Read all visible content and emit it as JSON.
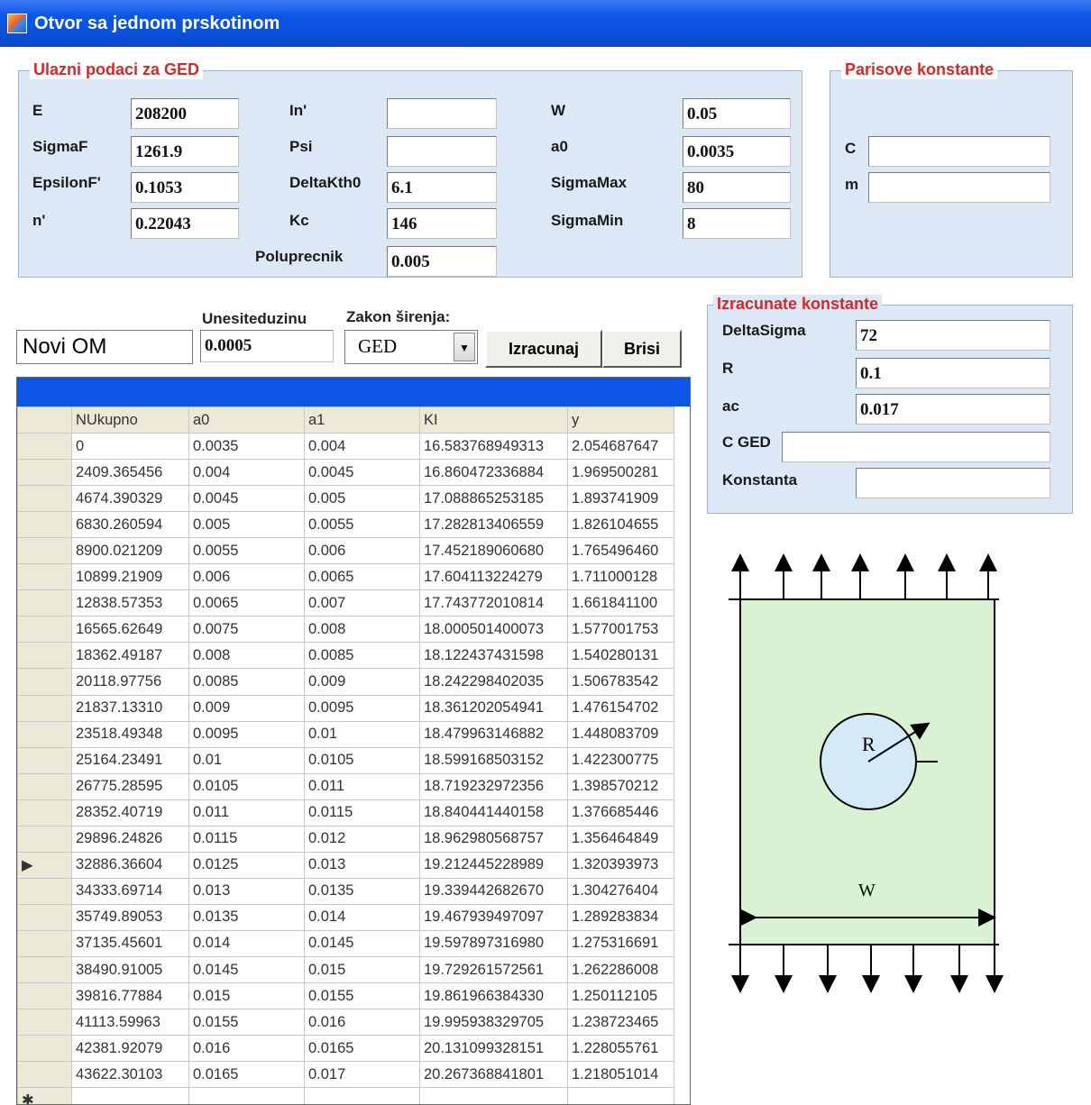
{
  "window": {
    "title": "Otvor sa jednom prskotinom"
  },
  "input_group": {
    "legend": "Ulazni podaci za GED",
    "E": {
      "label": "E",
      "value": "208200"
    },
    "SigmaF": {
      "label": "SigmaF",
      "value": "1261.9"
    },
    "EpsilonF": {
      "label": "EpsilonF'",
      "value": "0.1053"
    },
    "n": {
      "label": "n'",
      "value": "0.22043"
    },
    "In": {
      "label": "In'",
      "value": ""
    },
    "Psi": {
      "label": "Psi",
      "value": ""
    },
    "DeltaKth0": {
      "label": "DeltaKth0",
      "value": "6.1"
    },
    "Kc": {
      "label": "Kc",
      "value": "146"
    },
    "Poluprecnik": {
      "label": "Poluprecnik",
      "value": "0.005"
    },
    "W": {
      "label": "W",
      "value": "0.05"
    },
    "a0": {
      "label": "a0",
      "value": "0.0035"
    },
    "SigmaMax": {
      "label": "SigmaMax",
      "value": "80"
    },
    "SigmaMin": {
      "label": "SigmaMin",
      "value": "8"
    }
  },
  "paris_group": {
    "legend": "Parisove konstante",
    "C": {
      "label": "C",
      "value": ""
    },
    "m": {
      "label": "m",
      "value": ""
    }
  },
  "computed_group": {
    "legend": "Izracunate konstante",
    "DeltaSigma": {
      "label": "DeltaSigma",
      "value": "72"
    },
    "R": {
      "label": "R",
      "value": "0.1"
    },
    "ac": {
      "label": "ac",
      "value": "0.017"
    },
    "CGED": {
      "label": "C GED",
      "value": ""
    },
    "Konstanta": {
      "label": "Konstanta",
      "value": ""
    }
  },
  "controls": {
    "name_value": "Novi OM",
    "length_label": "Unesiteduzinu",
    "length_value": "0.0005",
    "law_label": "Zakon širenja:",
    "law_value": "GED",
    "calc_button": "Izracunaj",
    "clear_button": "Brisi"
  },
  "table": {
    "columns": [
      "NUkupno",
      "a0",
      "a1",
      "KI",
      "y"
    ],
    "rows": [
      [
        "0",
        "0.0035",
        "0.004",
        "16.583768949313",
        "2.054687647"
      ],
      [
        "2409.365456",
        "0.004",
        "0.0045",
        "16.860472336884",
        "1.969500281"
      ],
      [
        "4674.390329",
        "0.0045",
        "0.005",
        "17.088865253185",
        "1.893741909"
      ],
      [
        "6830.260594",
        "0.005",
        "0.0055",
        "17.282813406559",
        "1.826104655"
      ],
      [
        "8900.021209",
        "0.0055",
        "0.006",
        "17.452189060680",
        "1.765496460"
      ],
      [
        "10899.21909",
        "0.006",
        "0.0065",
        "17.604113224279",
        "1.711000128"
      ],
      [
        "12838.57353",
        "0.0065",
        "0.007",
        "17.743772010814",
        "1.661841100"
      ],
      [
        "16565.62649",
        "0.0075",
        "0.008",
        "18.000501400073",
        "1.577001753"
      ],
      [
        "18362.49187",
        "0.008",
        "0.0085",
        "18.122437431598",
        "1.540280131"
      ],
      [
        "20118.97756",
        "0.0085",
        "0.009",
        "18.242298402035",
        "1.506783542"
      ],
      [
        "21837.13310",
        "0.009",
        "0.0095",
        "18.361202054941",
        "1.476154702"
      ],
      [
        "23518.49348",
        "0.0095",
        "0.01",
        "18.479963146882",
        "1.448083709"
      ],
      [
        "25164.23491",
        "0.01",
        "0.0105",
        "18.599168503152",
        "1.422300775"
      ],
      [
        "26775.28595",
        "0.0105",
        "0.011",
        "18.719232972356",
        "1.398570212"
      ],
      [
        "28352.40719",
        "0.011",
        "0.0115",
        "18.840441440158",
        "1.376685446"
      ],
      [
        "29896.24826",
        "0.0115",
        "0.012",
        "18.962980568757",
        "1.356464849"
      ],
      [
        "32886.36604",
        "0.0125",
        "0.013",
        "19.212445228989",
        "1.320393973"
      ],
      [
        "34333.69714",
        "0.013",
        "0.0135",
        "19.339442682670",
        "1.304276404"
      ],
      [
        "35749.89053",
        "0.0135",
        "0.014",
        "19.467939497097",
        "1.289283834"
      ],
      [
        "37135.45601",
        "0.014",
        "0.0145",
        "19.597897316980",
        "1.275316691"
      ],
      [
        "38490.91005",
        "0.0145",
        "0.015",
        "19.729261572561",
        "1.262286008"
      ],
      [
        "39816.77884",
        "0.015",
        "0.0155",
        "19.861966384330",
        "1.250112105"
      ],
      [
        "41113.59963",
        "0.0155",
        "0.016",
        "19.995938329705",
        "1.238723465"
      ],
      [
        "42381.92079",
        "0.016",
        "0.0165",
        "20.131099328151",
        "1.228055761"
      ],
      [
        "43622.30103",
        "0.0165",
        "0.017",
        "20.267368841801",
        "1.218051014"
      ]
    ],
    "current_row_marker": "▶",
    "new_row_marker": "✱"
  },
  "diagram": {
    "radius_label": "R",
    "width_label": "W"
  },
  "colors": {
    "title_bar": "#0c55e6",
    "group_bg": "#dce8f6",
    "legend_red": "#d62828",
    "plate_green": "#d9f2d4",
    "hole_blue": "#d5eaf8"
  }
}
